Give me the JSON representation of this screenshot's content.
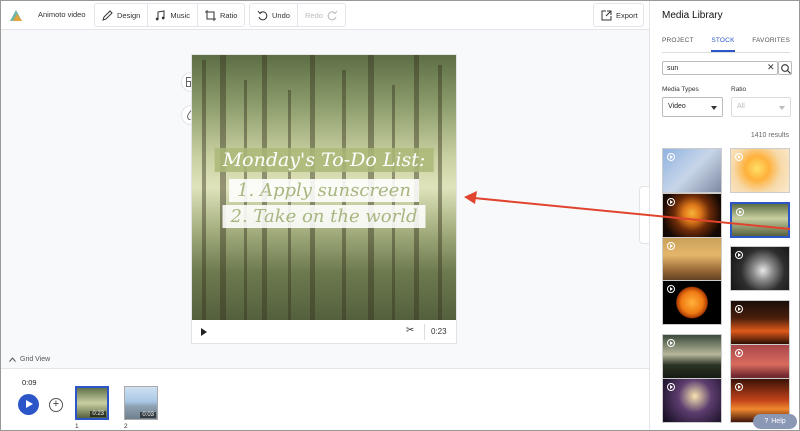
{
  "toolbar": {
    "project_name": "Animoto video",
    "design_label": "Design",
    "music_label": "Music",
    "ratio_label": "Ratio",
    "undo_label": "Undo",
    "redo_label": "Redo",
    "export_label": "Export"
  },
  "video": {
    "title_line1": "Monday's To-Do List:",
    "title_line2": "1. Apply sunscreen",
    "title_line3": "2. Take on the world",
    "duration": "0:23"
  },
  "grid_view_label": "Grid View",
  "timeline": {
    "current_time": "0:09",
    "scenes": [
      {
        "number": "1",
        "duration": "0:23"
      },
      {
        "number": "2",
        "duration": "0:03"
      }
    ]
  },
  "media_library": {
    "title": "Media Library",
    "tabs": [
      {
        "label": "PROJECT",
        "active": false
      },
      {
        "label": "STOCK",
        "active": true
      },
      {
        "label": "FAVORITES",
        "active": false
      }
    ],
    "search_value": "sun",
    "media_types_label": "Media Types",
    "media_types_value": "Video",
    "ratio_label": "Ratio",
    "ratio_value": "All",
    "results_text": "1410 results"
  },
  "help_label": "Help",
  "colors": {
    "accent": "#2c56c8",
    "arrow": "#e0442f"
  }
}
